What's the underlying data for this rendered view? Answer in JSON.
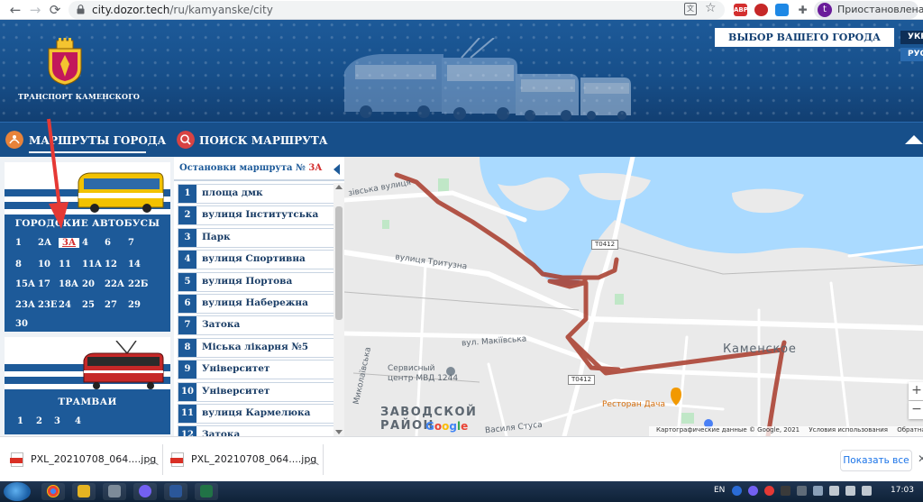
{
  "browser": {
    "url_host": "city.dozor.tech",
    "url_path": "/ru/kamyanske/city",
    "profile_initial": "t",
    "profile_label": "Приостановлена",
    "ext_abp": "ABP"
  },
  "header": {
    "brand": "ТРАНСПОРТ КАМЕНСКОГО",
    "city_select": "ВЫБОР ВАШЕГО ГОРОДА",
    "languages": [
      "УКР",
      "РУС"
    ]
  },
  "nav": {
    "routes": "МАРШРУТЫ ГОРОДА",
    "search": "ПОИСК МАРШРУТА"
  },
  "buses": {
    "title": "ГОРОДСКИЕ АВТОБУСЫ",
    "active": "3А",
    "rows": [
      [
        "1",
        "2А",
        "3А",
        "4",
        "6",
        "7"
      ],
      [
        "8",
        "10",
        "11",
        "11А",
        "12",
        "14"
      ],
      [
        "15А",
        "17",
        "18А",
        "20",
        "22А",
        "22Б"
      ],
      [
        "23А",
        "23Е",
        "24",
        "25",
        "27",
        "29"
      ],
      [
        "30"
      ]
    ]
  },
  "trams": {
    "title": "ТРАМВАИ",
    "rows": [
      [
        "1",
        "2",
        "3",
        "4"
      ]
    ]
  },
  "stops": {
    "title_prefix": "Остановки маршрута №",
    "route": "3А",
    "items": [
      {
        "n": "1",
        "name": "площа дмк"
      },
      {
        "n": "2",
        "name": "вулиця Інститутська"
      },
      {
        "n": "3",
        "name": "Парк"
      },
      {
        "n": "4",
        "name": "вулиця Спортивна"
      },
      {
        "n": "5",
        "name": "вулиця Портова"
      },
      {
        "n": "6",
        "name": "вулиця Набережна"
      },
      {
        "n": "7",
        "name": "Затока"
      },
      {
        "n": "8",
        "name": "Міська лікарня №5"
      },
      {
        "n": "9",
        "name": "Університет"
      },
      {
        "n": "10",
        "name": "Університет"
      },
      {
        "n": "11",
        "name": "вулиця Кармелюка"
      },
      {
        "n": "12",
        "name": "Затока"
      }
    ]
  },
  "map": {
    "labels": {
      "street_1": "зівська вулиця",
      "street_2": "вулиця Тритузна",
      "street_3": "вул. Макіївська",
      "street_4": "Миколаївська",
      "mvd": "Сервисный\nцентр МВД 1244",
      "district": "ЗАВОДСКОЙ\nРАЙОН",
      "city": "Каменское",
      "restaurant": "Ресторан Дача",
      "street_5": "Василя Стуса",
      "road_1": "Т0412",
      "road_2": "Т0412"
    },
    "google": "Google",
    "footer": {
      "data": "Картографические данные © Google, 2021",
      "terms": "Условия использования",
      "feedback": "Обратная связь"
    },
    "zoom_in": "+",
    "zoom_out": "−",
    "route_color": "#a83a2a"
  },
  "downloads": {
    "files": [
      "PXL_20210708_064....jpg",
      "PXL_20210708_064....jpg"
    ],
    "show_all": "Показать все"
  },
  "taskbar": {
    "lang": "EN",
    "time": "17:03"
  }
}
